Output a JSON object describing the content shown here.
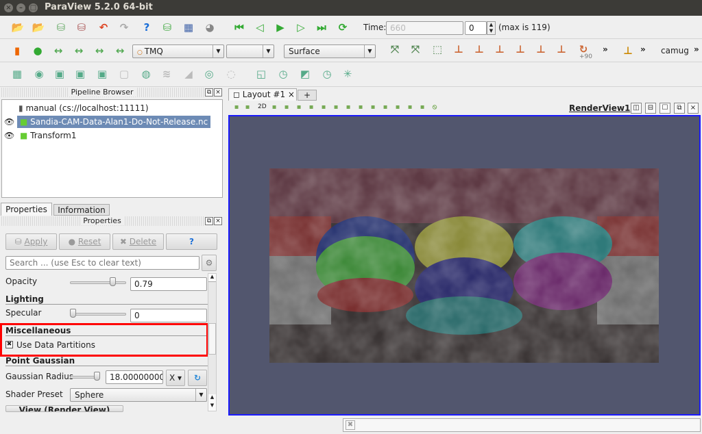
{
  "window": {
    "title": "ParaView 5.2.0 64-bit"
  },
  "toolbar1": {
    "icons": [
      "open-file",
      "load-state",
      "connect",
      "disconnect",
      "undo",
      "redo",
      "help",
      "save-state",
      "capture-screenshot",
      "color-palette",
      "first-frame",
      "previous-frame",
      "play",
      "next-frame",
      "last-frame",
      "loop"
    ],
    "time_label": "Time:",
    "time_value": "660",
    "timestep_value": "0",
    "max_label": "(max is 119)"
  },
  "toolbar2": {
    "icons": [
      "color-legend",
      "edit-colormap",
      "rescale-range",
      "rescale-custom",
      "rescale-temporal",
      "rescale-visible"
    ],
    "color_by": "TMQ",
    "component": "",
    "representation": "Surface",
    "camera_icons": [
      "reset-camera",
      "zoom-to-data",
      "zoom-to-box",
      "set-view-plus-x",
      "set-view-minus-x",
      "set-view-plus-y",
      "set-view-minus-y",
      "set-view-plus-z",
      "set-view-minus-z",
      "rotate-90"
    ],
    "rotate_label": "+90",
    "more": "»",
    "camug": "camug"
  },
  "toolbar3": {
    "icons": [
      "calculator",
      "contour",
      "clip",
      "slice",
      "threshold",
      "extract-subset",
      "glyph",
      "stream-tracer",
      "warp-by-vector",
      "group-datasets",
      "extract-level",
      "extract-selection",
      "plot-over-time",
      "plot-over-line",
      "plot-selection",
      "mirror"
    ]
  },
  "pipeline": {
    "title": "Pipeline Browser",
    "items": [
      {
        "label": "manual (cs://localhost:11111)"
      },
      {
        "label": "Sandia-CAM-Data-Alan1-Do-Not-Release.nc"
      },
      {
        "label": "Transform1"
      }
    ]
  },
  "properties": {
    "tabs": [
      "Properties",
      "Information"
    ],
    "title": "Properties",
    "apply": "Apply",
    "reset": "Reset",
    "delete": "Delete",
    "help": "?",
    "search_placeholder": "Search ... (use Esc to clear text)",
    "opacity_label": "Opacity",
    "opacity_value": "0.79",
    "opacity": 0.79,
    "lighting": "Lighting",
    "specular_label": "Specular",
    "specular_value": "0",
    "specular": 0,
    "misc": "Miscellaneous",
    "use_partitions": "Use Data Partitions",
    "use_partitions_checked": true,
    "point_gaussian": "Point Gaussian",
    "gaussian_radius_label": "Gaussian Radius",
    "gaussian_radius_value": "18.000000000",
    "radius_axis": "X",
    "shader_label": "Shader Preset",
    "shader_value": "Sphere",
    "view_section": "View (Render View)"
  },
  "layout": {
    "tab": "Layout #1",
    "add": "+",
    "view_name": "RenderView1",
    "view_btn_2d": "2D"
  },
  "colors": {
    "highlight": "#e00000",
    "render_bg": "#52566e",
    "view_border": "#1a1aff"
  }
}
